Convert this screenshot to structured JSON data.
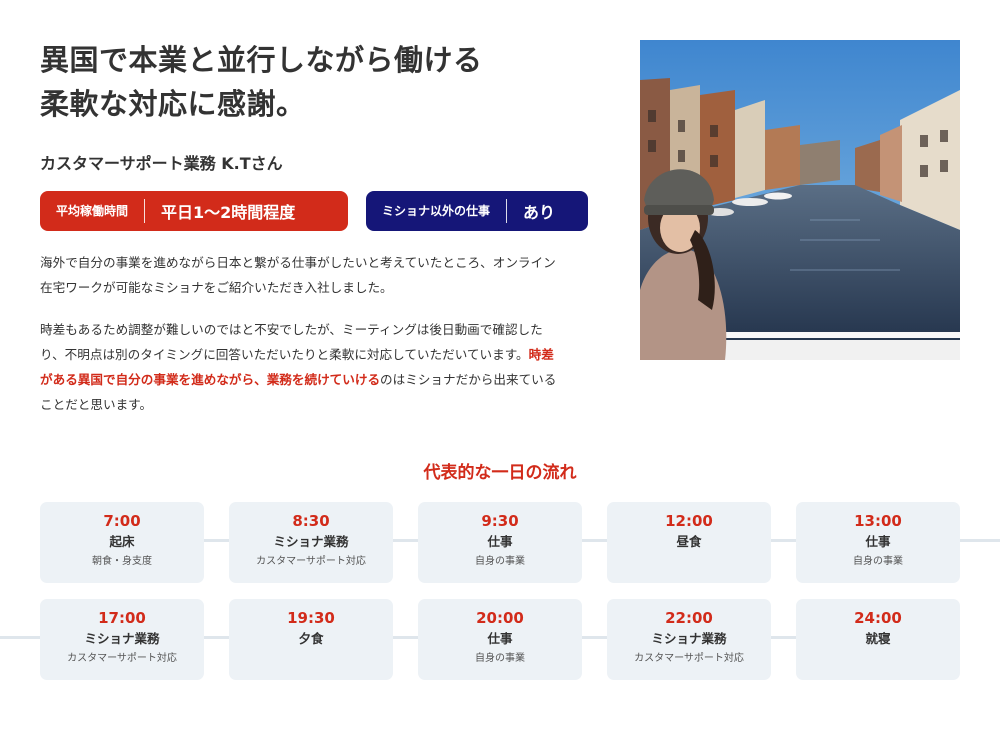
{
  "headline": {
    "line1": "異国で本業と並行しながら働ける",
    "line2": "柔軟な対応に感謝。"
  },
  "person": "カスタマーサポート業務 K.Tさん",
  "badges": [
    {
      "label": "平均稼働時間",
      "value": "平日1〜2時間程度",
      "color": "#d22b1a"
    },
    {
      "label": "ミショナ以外の仕事",
      "value": "あり",
      "color": "#151678"
    }
  ],
  "para1": {
    "line1": "海外で自分の事業を進めながら日本と繋がる仕事がしたいと考えていたところ、オンライン",
    "line2": "在宅ワークが可能なミショナをご紹介いただき入社しました。"
  },
  "para2": {
    "line1": "時差もあるため調整が難しいのではと不安でしたが、ミーティングは後日動画で確認した",
    "line2_plain": "り、不明点は別のタイミングに回答いただいたりと柔軟に対応していただいています。",
    "line2_hl": "時差",
    "line3_hl": "がある異国で自分の事業を進めながら、業務を続けていける",
    "line3_plain": "のはミショナだから出来ている",
    "line4": "ことだと思います。"
  },
  "photo": {
    "description": "woman-on-bridge-over-canal"
  },
  "flow_title": "代表的な一日の流れ",
  "schedule": [
    {
      "time": "7:00",
      "activity": "起床",
      "detail": "朝食・身支度"
    },
    {
      "time": "8:30",
      "activity": "ミショナ業務",
      "detail": "カスタマーサポート対応"
    },
    {
      "time": "9:30",
      "activity": "仕事",
      "detail": "自身の事業"
    },
    {
      "time": "12:00",
      "activity": "昼食",
      "detail": ""
    },
    {
      "time": "13:00",
      "activity": "仕事",
      "detail": "自身の事業"
    },
    {
      "time": "17:00",
      "activity": "ミショナ業務",
      "detail": "カスタマーサポート対応"
    },
    {
      "time": "19:30",
      "activity": "夕食",
      "detail": ""
    },
    {
      "time": "20:00",
      "activity": "仕事",
      "detail": "自身の事業"
    },
    {
      "time": "22:00",
      "activity": "ミショナ業務",
      "detail": "カスタマーサポート対応"
    },
    {
      "time": "24:00",
      "activity": "就寝",
      "detail": ""
    }
  ],
  "colors": {
    "accent": "#d22b1a",
    "navy": "#151678",
    "card_bg": "#edf2f6",
    "rail": "#dfe6ec"
  }
}
